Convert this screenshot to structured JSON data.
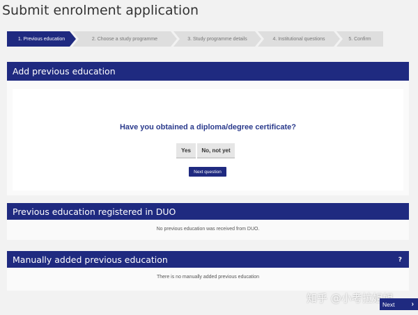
{
  "page": {
    "title": "Submit enrolment application"
  },
  "stepper": {
    "steps": [
      {
        "label": "1. Previous education",
        "active": true
      },
      {
        "label": "2. Choose a study programme",
        "active": false
      },
      {
        "label": "3. Study programme details",
        "active": false
      },
      {
        "label": "4. Institutional questions",
        "active": false
      },
      {
        "label": "5. Confirm",
        "active": false
      }
    ]
  },
  "add_education": {
    "header": "Add previous education",
    "question": "Have you obtained a diploma/degree certificate?",
    "yes_label": "Yes",
    "no_label": "No, not yet",
    "next_question_label": "Next question"
  },
  "duo": {
    "header": "Previous education registered in DUO",
    "message": "No previous education was received from DUO."
  },
  "manual": {
    "header": "Manually added previous education",
    "help_label": "?",
    "message": "There is no manually added previous education"
  },
  "footer": {
    "next_label": "Next",
    "next_icon": "chevron-right-icon"
  },
  "watermark": "知乎 @小考拉姐姐",
  "colors": {
    "primary": "#1f2a80",
    "step_inactive": "#dedede",
    "background": "#f2f2f2"
  }
}
